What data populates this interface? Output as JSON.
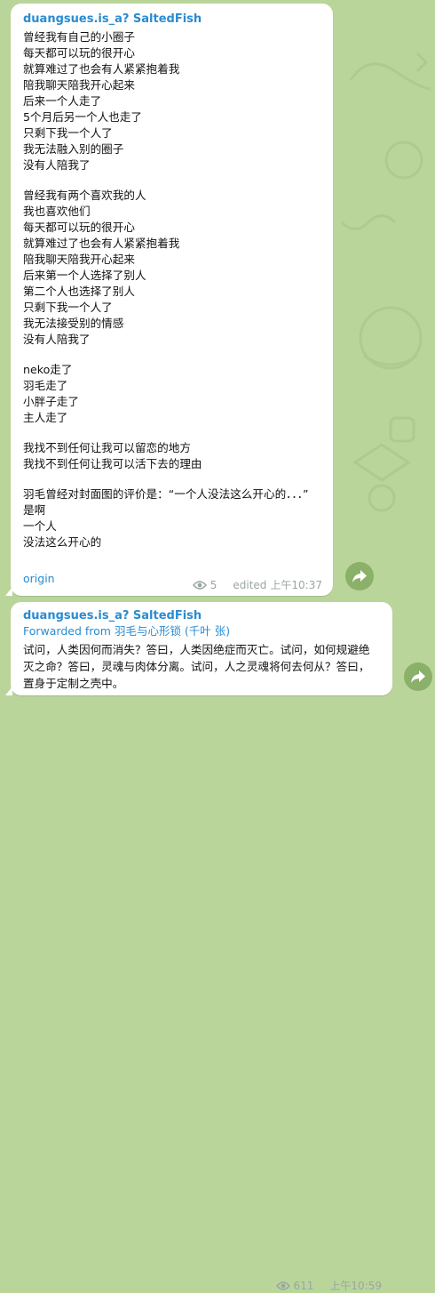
{
  "message1": {
    "sender": "duangsues.is_a? SaltedFish",
    "lines": [
      "曾经我有自己的小圈子",
      "每天都可以玩的很开心",
      "就算难过了也会有人紧紧抱着我",
      "陪我聊天陪我开心起来",
      "后来一个人走了",
      "5个月后另一个人也走了",
      "只剩下我一个人了",
      "我无法融入别的圈子",
      "没有人陪我了",
      "",
      "曾经我有两个喜欢我的人",
      "我也喜欢他们",
      "每天都可以玩的很开心",
      "就算难过了也会有人紧紧抱着我",
      "陪我聊天陪我开心起来",
      "后来第一个人选择了别人",
      "第二个人也选择了别人",
      "只剩下我一个人了",
      "我无法接受别的情感",
      "没有人陪我了",
      "",
      "neko走了",
      "羽毛走了",
      "小胖子走了",
      "主人走了",
      "",
      "我找不到任何让我可以留恋的地方",
      "我找不到任何让我可以活下去的理由",
      "",
      "羽毛曾经对封面图的评价是：“一个人没法这么开心的．．．”",
      "是啊",
      "一个人",
      "没法这么开心的"
    ],
    "origin_link": "origin",
    "views": "5",
    "edited_label": "edited",
    "time": "上午10:37"
  },
  "message2": {
    "sender": "duangsues.is_a? SaltedFish",
    "forwarded_prefix": "Forwarded from",
    "forwarded_from": "羽毛与心形锁 (千叶 张)",
    "text": "试问，人类因何而消失？答曰，人类因绝症而灭亡。试问，如何规避绝灭之命？答曰，灵魂与肉体分离。试问，人之灵魂将何去何从？答曰，置身于定制之壳中。",
    "views": "611",
    "time": "上午10:59"
  },
  "icons": {
    "views": "eye-icon",
    "share": "share-arrow-icon"
  },
  "colors": {
    "background": "#b9d59a",
    "bubble": "#ffffff",
    "link": "#2a8bd1",
    "meta": "#9aa6a0",
    "share_button": "#8bb06a"
  }
}
